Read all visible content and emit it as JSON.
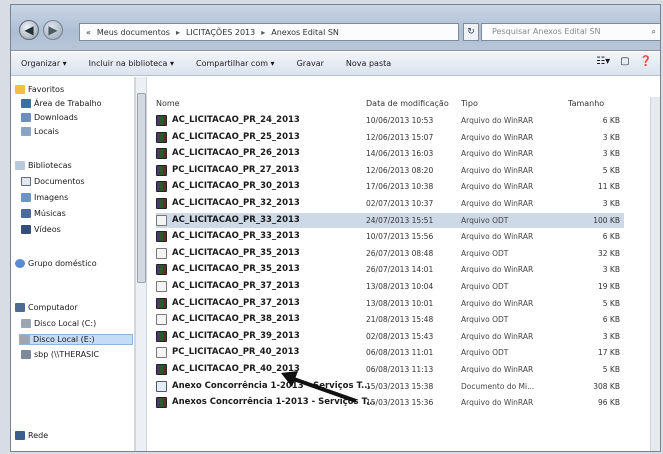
{
  "address": {
    "segments": [
      "«",
      "Meus documentos",
      "LICITAÇÕES 2013",
      "Anexos Edital SN"
    ]
  },
  "search": {
    "placeholder": "Pesquisar Anexos Edital SN"
  },
  "toolbar": {
    "organize": "Organizar ▾",
    "include_library": "Incluir na biblioteca ▾",
    "share": "Compartilhar com ▾",
    "burn": "Gravar",
    "new_folder": "Nova pasta"
  },
  "nav": {
    "favorites": "Favoritos",
    "desktop": "Área de Trabalho",
    "downloads": "Downloads",
    "recent": "Locais",
    "libraries": "Bibliotecas",
    "documents": "Documentos",
    "images": "Imagens",
    "music": "Músicas",
    "videos": "Vídeos",
    "homegroup": "Grupo doméstico",
    "computer": "Computador",
    "disk_c": "Disco Local (C:)",
    "disk_d": "Disco Local (E:)",
    "network_drive": "sbp (\\\\THERASIC",
    "network": "Rede"
  },
  "columns": {
    "name": "Nome",
    "date": "Data de modificação",
    "type": "Tipo",
    "size": "Tamanho"
  },
  "files": [
    {
      "name": "AC_LICITACAO_PR_24_2013",
      "date": "10/06/2013 10:53",
      "type": "Arquivo do WinRAR",
      "size": "6 KB",
      "kind": "rar"
    },
    {
      "name": "AC_LICITACAO_PR_25_2013",
      "date": "12/06/2013 15:07",
      "type": "Arquivo do WinRAR",
      "size": "3 KB",
      "kind": "rar"
    },
    {
      "name": "AC_LICITACAO_PR_26_2013",
      "date": "14/06/2013 16:03",
      "type": "Arquivo do WinRAR",
      "size": "3 KB",
      "kind": "rar"
    },
    {
      "name": "PC_LICITACAO_PR_27_2013",
      "date": "12/06/2013 08:20",
      "type": "Arquivo do WinRAR",
      "size": "5 KB",
      "kind": "rar"
    },
    {
      "name": "AC_LICITACAO_PR_30_2013",
      "date": "17/06/2013 10:38",
      "type": "Arquivo do WinRAR",
      "size": "11 KB",
      "kind": "rar"
    },
    {
      "name": "AC_LICITACAO_PR_32_2013",
      "date": "02/07/2013 10:37",
      "type": "Arquivo do WinRAR",
      "size": "3 KB",
      "kind": "rar"
    },
    {
      "name": "AC_LICITACAO_PR_33_2013",
      "date": "24/07/2013 15:51",
      "type": "Arquivo ODT",
      "size": "100 KB",
      "kind": "odt"
    },
    {
      "name": "AC_LICITACAO_PR_33_2013",
      "date": "10/07/2013 15:56",
      "type": "Arquivo do WinRAR",
      "size": "6 KB",
      "kind": "rar"
    },
    {
      "name": "AC_LICITACAO_PR_35_2013",
      "date": "26/07/2013 08:48",
      "type": "Arquivo ODT",
      "size": "32 KB",
      "kind": "odt"
    },
    {
      "name": "AC_LICITACAO_PR_35_2013",
      "date": "26/07/2013 14:01",
      "type": "Arquivo do WinRAR",
      "size": "3 KB",
      "kind": "rar"
    },
    {
      "name": "AC_LICITACAO_PR_37_2013",
      "date": "13/08/2013 10:04",
      "type": "Arquivo ODT",
      "size": "19 KB",
      "kind": "odt"
    },
    {
      "name": "AC_LICITACAO_PR_37_2013",
      "date": "13/08/2013 10:01",
      "type": "Arquivo do WinRAR",
      "size": "5 KB",
      "kind": "rar"
    },
    {
      "name": "AC_LICITACAO_PR_38_2013",
      "date": "21/08/2013 15:48",
      "type": "Arquivo ODT",
      "size": "6 KB",
      "kind": "odt"
    },
    {
      "name": "AC_LICITACAO_PR_39_2013",
      "date": "02/08/2013 15:43",
      "type": "Arquivo do WinRAR",
      "size": "3 KB",
      "kind": "rar"
    },
    {
      "name": "PC_LICITACAO_PR_40_2013",
      "date": "06/08/2013 11:01",
      "type": "Arquivo ODT",
      "size": "17 KB",
      "kind": "odt"
    },
    {
      "name": "AC_LICITACAO_PR_40_2013",
      "date": "06/08/2013 11:13",
      "type": "Arquivo do WinRAR",
      "size": "5 KB",
      "kind": "rar"
    },
    {
      "name": "Anexo Concorrência 1-2013 - Serviços T...",
      "date": "15/03/2013 15:38",
      "type": "Documento do Mi...",
      "size": "308 KB",
      "kind": "doc"
    },
    {
      "name": "Anexos Concorrência 1-2013 - Serviços T...",
      "date": "15/03/2013 15:36",
      "type": "Arquivo do WinRAR",
      "size": "96 KB",
      "kind": "rar"
    }
  ],
  "selected_row": 6,
  "colors": {
    "selection": "#cdd9e7",
    "arrow": "#111111"
  }
}
